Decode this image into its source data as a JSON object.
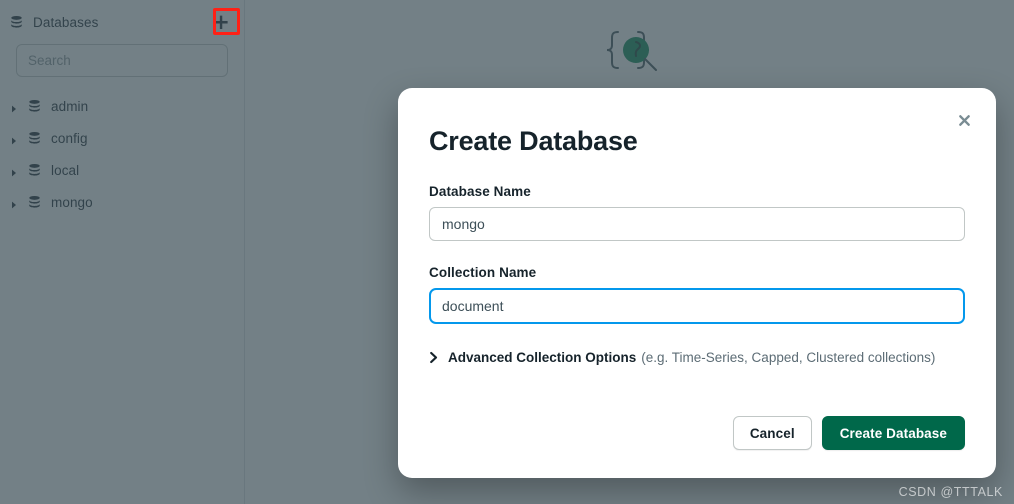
{
  "sidebar": {
    "header_title": "Databases",
    "header_icon": "database-stack-icon",
    "add_button_icon": "plus-icon",
    "add_button_label": "+",
    "search": {
      "value": "",
      "placeholder": "Search"
    },
    "items": [
      {
        "label": "admin",
        "icon": "database-stack-icon",
        "caret": "caret-right-icon",
        "expanded": false
      },
      {
        "label": "config",
        "icon": "database-stack-icon",
        "caret": "caret-right-icon",
        "expanded": false
      },
      {
        "label": "local",
        "icon": "database-stack-icon",
        "caret": "caret-right-icon",
        "expanded": false
      },
      {
        "label": "mongo",
        "icon": "database-stack-icon",
        "caret": "caret-right-icon",
        "expanded": false
      }
    ]
  },
  "main": {
    "empty_state_icon": "braces-magnifier-icon",
    "empty_title": "",
    "empty_sub": ""
  },
  "modal": {
    "title": "Create Database",
    "close_icon": "close-icon",
    "close_label": "✖",
    "fields": [
      {
        "label": "Database Name",
        "value": "mongo",
        "placeholder": "",
        "focused": false,
        "name": "database-name"
      },
      {
        "label": "Collection Name",
        "value": "document",
        "placeholder": "",
        "focused": true,
        "name": "collection-name"
      }
    ],
    "advanced": {
      "chevron_icon": "chevron-right-icon",
      "title": "Advanced Collection Options",
      "hint": "(e.g. Time-Series, Capped, Clustered collections)",
      "expanded": false
    },
    "buttons": {
      "cancel_label": "Cancel",
      "primary_label": "Create Database"
    }
  },
  "watermark": "CSDN @TTTALK",
  "colors": {
    "brand_green": "#00684a",
    "focus_blue": "#0498ec",
    "annotation_red": "#ff2116",
    "scrim": "#3d4f58",
    "text_dark": "#16232b",
    "text_muted": "#5c6c75"
  }
}
